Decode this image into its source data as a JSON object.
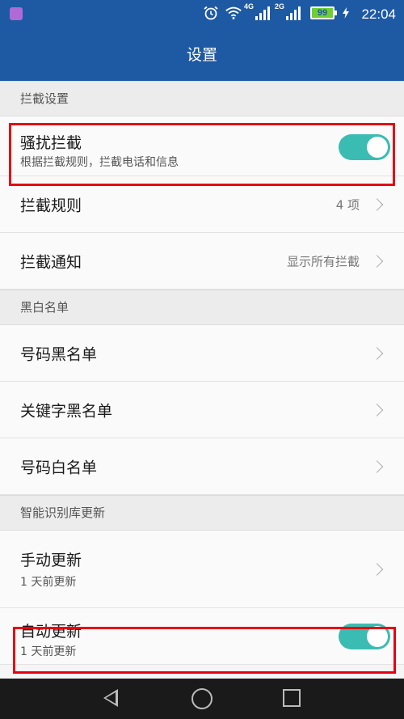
{
  "status_bar": {
    "time": "22:04",
    "battery": "99",
    "network_1": "4G",
    "network_2": "2G",
    "icons": [
      "gallery-notification-icon",
      "alarm-icon",
      "wifi-icon",
      "signal-icon",
      "signal-icon",
      "battery-icon",
      "charging-icon"
    ]
  },
  "app_bar": {
    "title": "设置"
  },
  "sections": {
    "intercept_settings": "拦截设置",
    "black_white_list": "黑白名单",
    "smart_db_update": "智能识别库更新"
  },
  "rows": {
    "harassment_intercept": {
      "label": "骚扰拦截",
      "sub": "根据拦截规则，拦截电话和信息",
      "enabled": true
    },
    "intercept_rules": {
      "label": "拦截规则",
      "value": "4 项"
    },
    "intercept_notify": {
      "label": "拦截通知",
      "value": "显示所有拦截"
    },
    "number_blacklist": {
      "label": "号码黑名单"
    },
    "keyword_blacklist": {
      "label": "关键字黑名单"
    },
    "number_whitelist": {
      "label": "号码白名单"
    },
    "manual_update": {
      "label": "手动更新",
      "sub": "1 天前更新"
    },
    "auto_update": {
      "label": "自动更新",
      "sub": "1 天前更新",
      "enabled": true
    }
  },
  "colors": {
    "primary": "#1e5aa3",
    "toggle_on": "#3bbcb2",
    "highlight": "#e60012"
  }
}
